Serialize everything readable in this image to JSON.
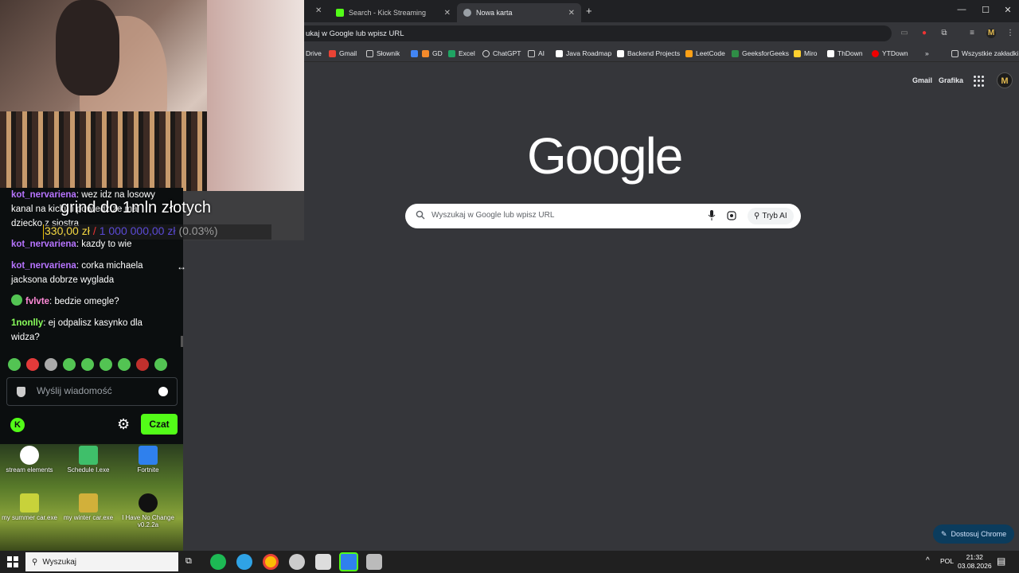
{
  "browser": {
    "tabs": [
      {
        "title": "Search - Kick Streaming"
      },
      {
        "title": "Nowa karta"
      }
    ],
    "omnibox": "ukaj w Google lub wpisz URL",
    "bookmarks": [
      "Drive",
      "Gmail",
      "Słownik",
      "GD",
      "Excel",
      "ChatGPT",
      "AI",
      "Java Roadmap",
      "Backend Projects",
      "LeetCode",
      "GeeksforGeeks",
      "Miro",
      "ThDown",
      "YTDown"
    ],
    "all_bookmarks": "Wszystkie zakładki",
    "more": "»"
  },
  "ntp": {
    "top_links": {
      "gmail": "Gmail",
      "images": "Grafika"
    },
    "avatar_letter": "M",
    "logo": "Google",
    "search_placeholder": "Wyszukaj w Google lub wpisz URL",
    "ai_mode": "Tryb AI",
    "customize": "Dostosuj Chrome"
  },
  "stream_overlay": {
    "goal_title": "grind do 1mln złotych",
    "current": "330,00 zł",
    "target": "1 000 000,00 zł",
    "percent": "(0.03%)",
    "progress_fraction": 0.0003
  },
  "chat": {
    "messages": [
      {
        "user": "kot_nervariena",
        "text": "wez idz na losowy kanal na kicku i powiedz ze ma dziecko z siostra",
        "color": "#b774ff"
      },
      {
        "user": "kot_nervariena",
        "text": "kazdy to wie",
        "color": "#b774ff"
      },
      {
        "user": "kot_nervariena",
        "text": "corka michaela jacksona dobrze wyglada",
        "color": "#b774ff"
      },
      {
        "user": "fvlvte",
        "text": "bedzie omegle?",
        "color": "#ff8ad8"
      },
      {
        "user": "1nonlly",
        "text": "ej odpalisz kasynko dla widza?",
        "color": "#8aff5c"
      }
    ],
    "input_placeholder": "Wyślij wiadomość",
    "send_label": "Czat",
    "accent": "#53fc18"
  },
  "desktop": {
    "icons": [
      "stream elements",
      "Schedule I.exe",
      "Fortnite",
      "my summer car.exe",
      "my winter car.exe",
      "I Have No Change v0.2.2a"
    ]
  },
  "taskbar": {
    "search_label": "Wyszukaj",
    "lang": "POL",
    "time": "21:32",
    "date": "03.08.2026"
  }
}
